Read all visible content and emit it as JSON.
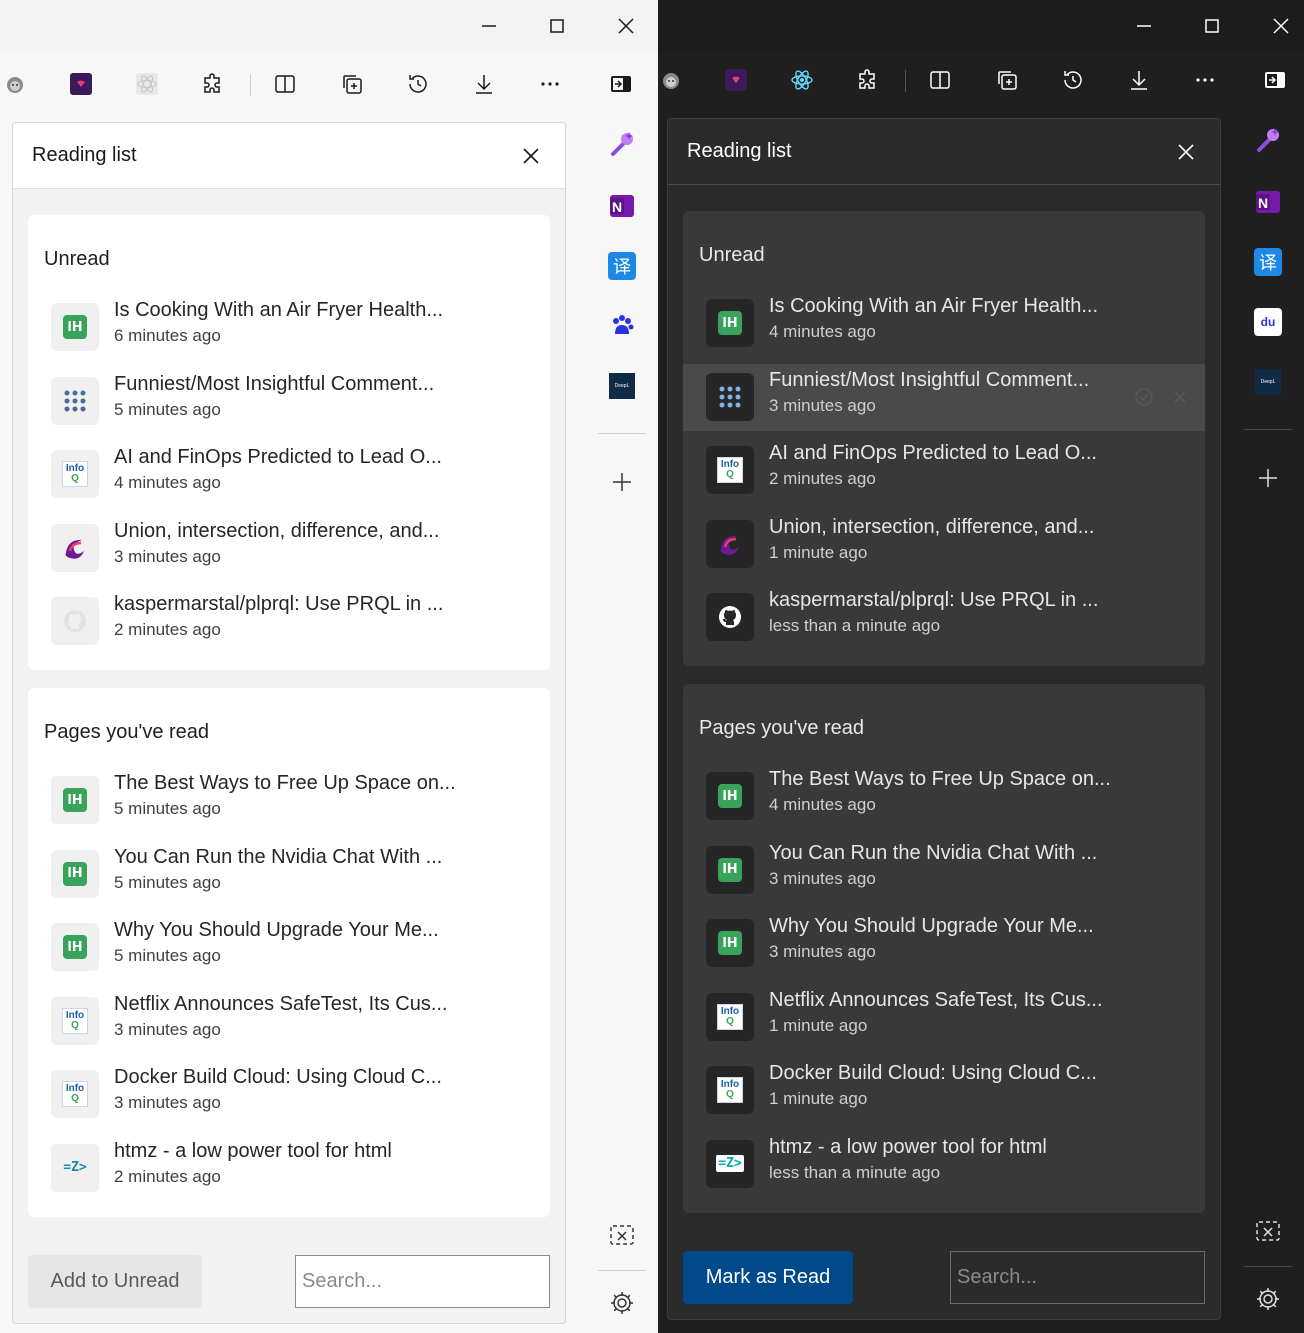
{
  "light": {
    "reading_list": {
      "title": "Reading list",
      "unread_heading": "Unread",
      "unread": [
        {
          "title": "Is Cooking With an Air Fryer Health...",
          "time": "6 minutes ago",
          "icon": "lifehacker-icon"
        },
        {
          "title": "Funniest/Most Insightful Comment...",
          "time": "5 minutes ago",
          "icon": "dots-grid-icon"
        },
        {
          "title": "AI and FinOps Predicted to Lead O...",
          "time": "4 minutes ago",
          "icon": "infoq-icon"
        },
        {
          "title": "Union, intersection, difference, and...",
          "time": "3 minutes ago",
          "icon": "swirl-icon"
        },
        {
          "title": "kaspermarstal/plprql: Use PRQL in ...",
          "time": "2 minutes ago",
          "icon": "github-icon"
        }
      ],
      "read_heading": "Pages you've read",
      "read": [
        {
          "title": "The Best Ways to Free Up Space on...",
          "time": "5 minutes ago",
          "icon": "lifehacker-icon"
        },
        {
          "title": "You Can Run the Nvidia Chat With ...",
          "time": "5 minutes ago",
          "icon": "lifehacker-icon"
        },
        {
          "title": "Why You Should Upgrade Your Me...",
          "time": "5 minutes ago",
          "icon": "lifehacker-icon"
        },
        {
          "title": "Netflix Announces SafeTest, Its Cus...",
          "time": "3 minutes ago",
          "icon": "infoq-icon"
        },
        {
          "title": "Docker Build Cloud: Using Cloud C...",
          "time": "3 minutes ago",
          "icon": "infoq-icon"
        },
        {
          "title": "htmz - a low power tool for html",
          "time": "2 minutes ago",
          "icon": "htmz-icon"
        }
      ],
      "button": "Add to Unread",
      "search_placeholder": "Search..."
    }
  },
  "dark": {
    "reading_list": {
      "title": "Reading list",
      "unread_heading": "Unread",
      "unread": [
        {
          "title": "Is Cooking With an Air Fryer Health...",
          "time": "4 minutes ago",
          "icon": "lifehacker-icon"
        },
        {
          "title": "Funniest/Most Insightful Comment...",
          "time": "3 minutes ago",
          "icon": "dots-grid-icon"
        },
        {
          "title": "AI and FinOps Predicted to Lead O...",
          "time": "2 minutes ago",
          "icon": "infoq-icon"
        },
        {
          "title": "Union, intersection, difference, and...",
          "time": "1 minute ago",
          "icon": "swirl-icon"
        },
        {
          "title": "kaspermarstal/plprql: Use PRQL in ...",
          "time": "less than a minute ago",
          "icon": "github-icon"
        }
      ],
      "read_heading": "Pages you've read",
      "read": [
        {
          "title": "The Best Ways to Free Up Space on...",
          "time": "4 minutes ago",
          "icon": "lifehacker-icon"
        },
        {
          "title": "You Can Run the Nvidia Chat With ...",
          "time": "3 minutes ago",
          "icon": "lifehacker-icon"
        },
        {
          "title": "Why You Should Upgrade Your Me...",
          "time": "3 minutes ago",
          "icon": "lifehacker-icon"
        },
        {
          "title": "Netflix Announces SafeTest, Its Cus...",
          "time": "1 minute ago",
          "icon": "infoq-icon"
        },
        {
          "title": "Docker Build Cloud: Using Cloud C...",
          "time": "1 minute ago",
          "icon": "infoq-icon"
        },
        {
          "title": "htmz - a low power tool for html",
          "time": "less than a minute ago",
          "icon": "htmz-icon"
        }
      ],
      "button": "Mark as Read",
      "search_placeholder": "Search..."
    }
  },
  "favicon_text": {
    "lifehacker": "lH",
    "infoq_top": "Info",
    "infoq_bottom": "Q",
    "htmz": "=Z>"
  },
  "sidebar_glyphs": {
    "translate": "译",
    "baidu": "du",
    "deepl": "DeepL"
  },
  "colors": {
    "light_bg": "#f7f7f7",
    "dark_bg": "#1f1f1f",
    "accent_blue": "#004a8c",
    "favicon_green": "#3aa35b"
  }
}
